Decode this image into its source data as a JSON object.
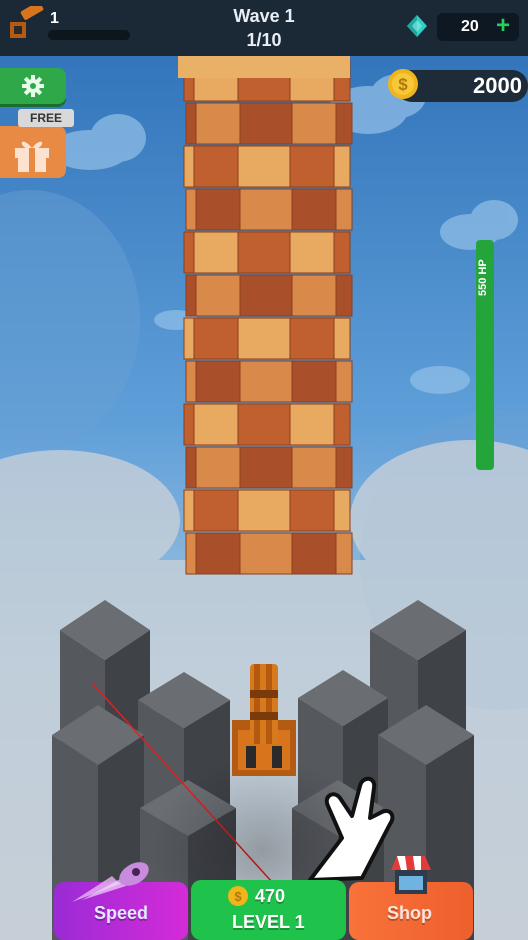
{
  "top_bar": {
    "player_level": "1",
    "wave_title": "Wave 1",
    "wave_progress": "1/10",
    "gem_count": "20",
    "gem_plus": "+"
  },
  "side_buttons": {
    "settings_icon": "gear-icon",
    "gift_icon": "gift-icon",
    "free_tag": "FREE"
  },
  "coins": {
    "value": "2000",
    "symbol": "$"
  },
  "enemy_tower": {
    "hp_label": "550 HP",
    "hp_fraction": 1.0
  },
  "bottom_bar": {
    "speed_label": "Speed",
    "upgrade_cost": "470",
    "upgrade_level": "LEVEL 1",
    "coin_symbol": "$",
    "shop_label": "Shop"
  },
  "colors": {
    "sky_top": "#2c6fb6",
    "sky_bottom": "#bcd3e6",
    "brick_dark": "#c0602f",
    "brick_light": "#e8a961",
    "pillar_top": "#686b70",
    "pillar_side": "#4a4d52",
    "hp_green": "#23a53c",
    "upgrade_green": "#1fc24b",
    "speed_purple": "#b22bd6",
    "shop_orange": "#f46c35"
  }
}
